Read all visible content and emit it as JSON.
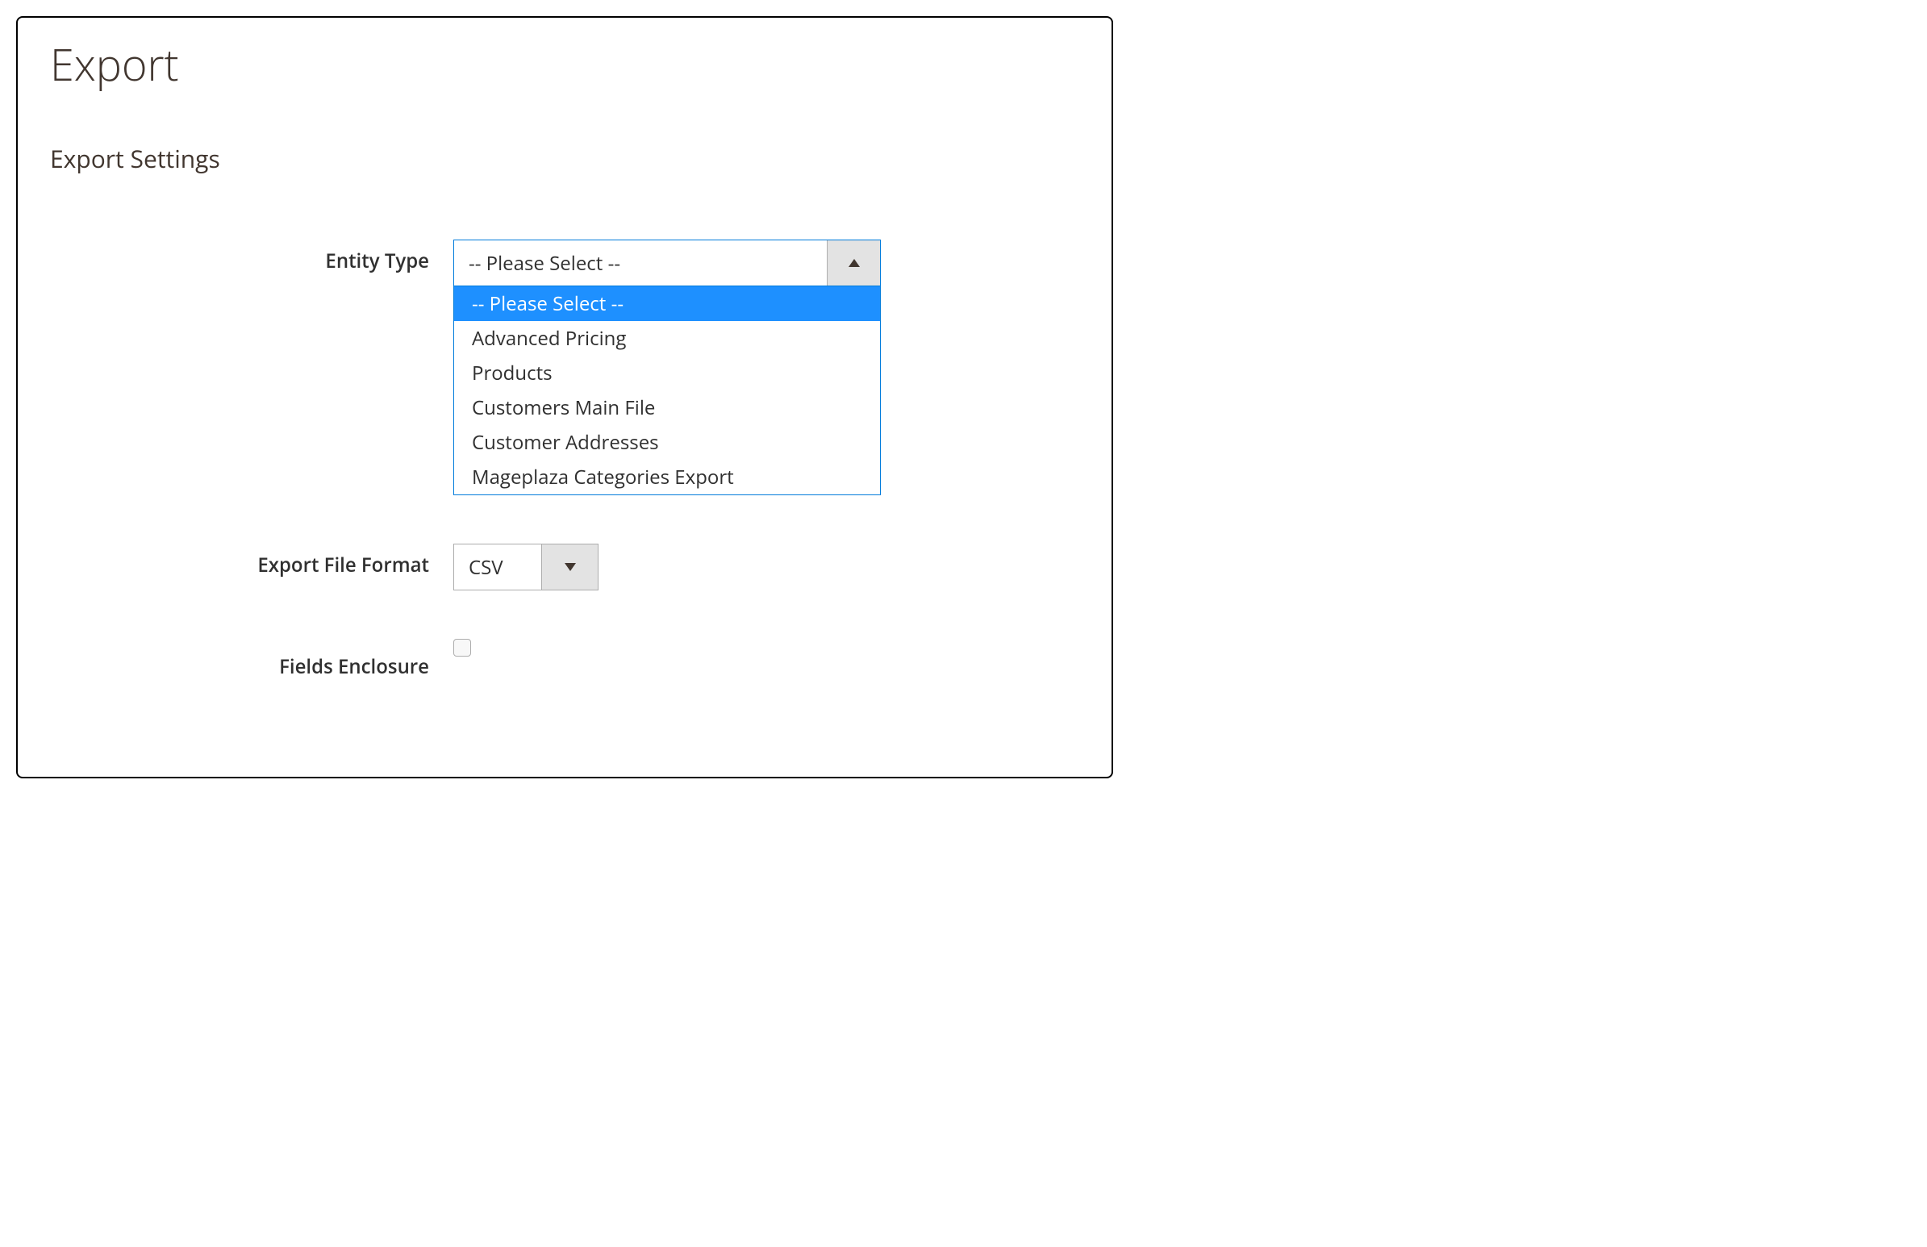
{
  "page": {
    "title": "Export",
    "section_title": "Export Settings"
  },
  "form": {
    "entity_type": {
      "label": "Entity Type",
      "selected": "-- Please Select --",
      "options": [
        "-- Please Select --",
        "Advanced Pricing",
        "Products",
        "Customers Main File",
        "Customer Addresses",
        "Mageplaza Categories Export"
      ]
    },
    "file_format": {
      "label": "Export File Format",
      "selected": "CSV"
    },
    "fields_enclosure": {
      "label": "Fields Enclosure"
    }
  }
}
